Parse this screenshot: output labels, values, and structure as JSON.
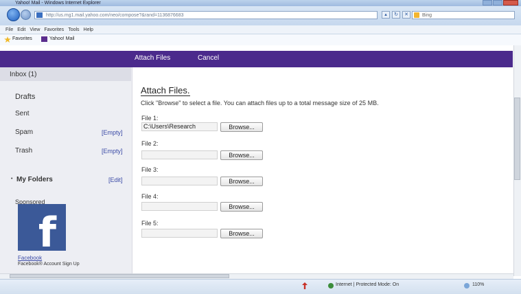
{
  "browser": {
    "title": "Yahoo! Mail - Windows Internet Explorer",
    "address": "http://us.mg1.mail.yahoo.com/neo/compose?&rand=1136876683",
    "search_placeholder": "Bing",
    "menu": [
      "File",
      "Edit",
      "View",
      "Favorites",
      "Tools",
      "Help"
    ],
    "favorites_label": "Favorites",
    "fav_tab": "Yahoo! Mail",
    "status_zone": "Internet | Protected Mode: On",
    "zoom": "110%"
  },
  "toolbar": {
    "attach_label": "Attach Files",
    "cancel_label": "Cancel"
  },
  "sidebar": {
    "inbox": "Inbox (1)",
    "drafts": "Drafts",
    "sent": "Sent",
    "spam": "Spam",
    "spam_action": "[Empty]",
    "trash": "Trash",
    "trash_action": "[Empty]",
    "folders": "My Folders",
    "folders_action": "[Edit]",
    "sponsored": "Sponsored",
    "ad_title": "Facebook",
    "ad_text": "Facebook® Account Sign Up",
    "ad_logo_letter": "f"
  },
  "main": {
    "heading": "Attach Files.",
    "description": "Click \"Browse\" to select a file. You can attach files up to a total message size of 25 MB.",
    "browse_label": "Browse...",
    "files": [
      {
        "label": "File 1:",
        "value": "C:\\Users\\Research"
      },
      {
        "label": "File 2:",
        "value": ""
      },
      {
        "label": "File 3:",
        "value": ""
      },
      {
        "label": "File 4:",
        "value": ""
      },
      {
        "label": "File 5:",
        "value": ""
      }
    ]
  },
  "colors": {
    "brand_purple": "#4b2a8c",
    "facebook_blue": "#3b5998"
  }
}
